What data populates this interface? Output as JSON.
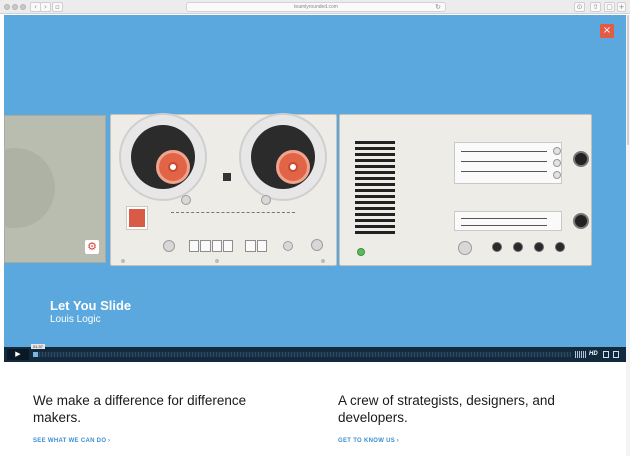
{
  "browser": {
    "url": "teamlyrounded.com",
    "back": "‹",
    "forward": "›",
    "reload": "↻"
  },
  "hero": {
    "close": "×",
    "background": "#5aa8dd",
    "track_title": "Let You Slide",
    "track_artist": "Louis Logic"
  },
  "player": {
    "play": "▶",
    "time": "01:37",
    "progress": 0.01,
    "hd": "HD"
  },
  "sections": [
    {
      "heading": "We make a difference for difference makers.",
      "link": "SEE WHAT WE CAN DO",
      "arrow": "›"
    },
    {
      "heading": "A crew of strategists, designers, and developers.",
      "link": "GET TO KNOW US",
      "arrow": "›"
    }
  ],
  "colors": {
    "accent": "#3c8ed1",
    "close": "#e35a45",
    "reel_hub": "#e26447"
  }
}
